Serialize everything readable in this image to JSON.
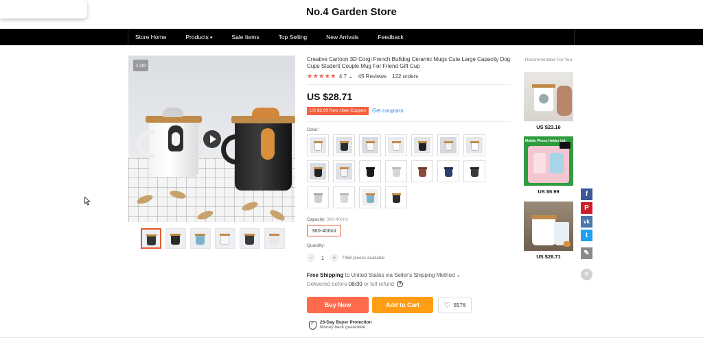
{
  "store": {
    "title": "No.4 Garden Store"
  },
  "nav": {
    "items": [
      {
        "label": "Store Home"
      },
      {
        "label": "Products",
        "caret": "▾"
      },
      {
        "label": "Sale Items"
      },
      {
        "label": "Top Selling"
      },
      {
        "label": "New Arrivals"
      },
      {
        "label": "Feedback"
      }
    ]
  },
  "gallery": {
    "zoom_badge": "1.00",
    "thumbnail_count": 6
  },
  "product": {
    "title": "Creative Cartoon 3D Corgi French Bulldog Ceramic Mugs Cute Large Capacity Dog Cups Student Couple Mug For Friend Gift Cup",
    "stars": "★★★★★",
    "rating": "4.7",
    "rating_caret": "⌄",
    "reviews": "45 Reviews",
    "orders": "122 orders",
    "price": "US $28.71",
    "coupon_tag": "US $2.00 New User Coupon",
    "coupon_link": "Get coupons",
    "color_label": "Color:",
    "capacity_label": "Capacity:",
    "capacity_value_hint": "360-400ml",
    "capacity_option": "360-400ml",
    "quantity_label": "Quantity:",
    "qty_minus": "−",
    "qty_value": "1",
    "qty_plus": "+",
    "stock": "7468 pieces available",
    "free_shipping": "Free Shipping",
    "shipping_rest": " to United States via Seller's Shipping Method ⌄",
    "delivered_before": "Delivered before",
    "delivery_date": "08/30",
    "full_refund": "or full refund",
    "help_glyph": "?",
    "buy_now": "Buy Now",
    "add_to_cart": "Add to Cart",
    "wishlist_icon": "♡",
    "wishlist_count": "5576",
    "protection_title": "23-Day Buyer Protection",
    "protection_sub": "Money back guarantee"
  },
  "colors": {
    "accent": "#e55a2b",
    "buy_now": "#ff6a4d",
    "add_to_cart": "#ff9e14",
    "coupon": "#f75f3d",
    "link": "#2e86de"
  },
  "recommended": {
    "title": "Recommended For You",
    "items": [
      {
        "price": "US $23.16"
      },
      {
        "price": "US $5.99",
        "badge": "Mobile Phone Holder Lid"
      },
      {
        "price": "US $28.71"
      }
    ]
  },
  "share": {
    "facebook": "f",
    "pinterest": "P",
    "vk": "vk",
    "twitter": "t",
    "edit": "✎",
    "close": "✕"
  }
}
